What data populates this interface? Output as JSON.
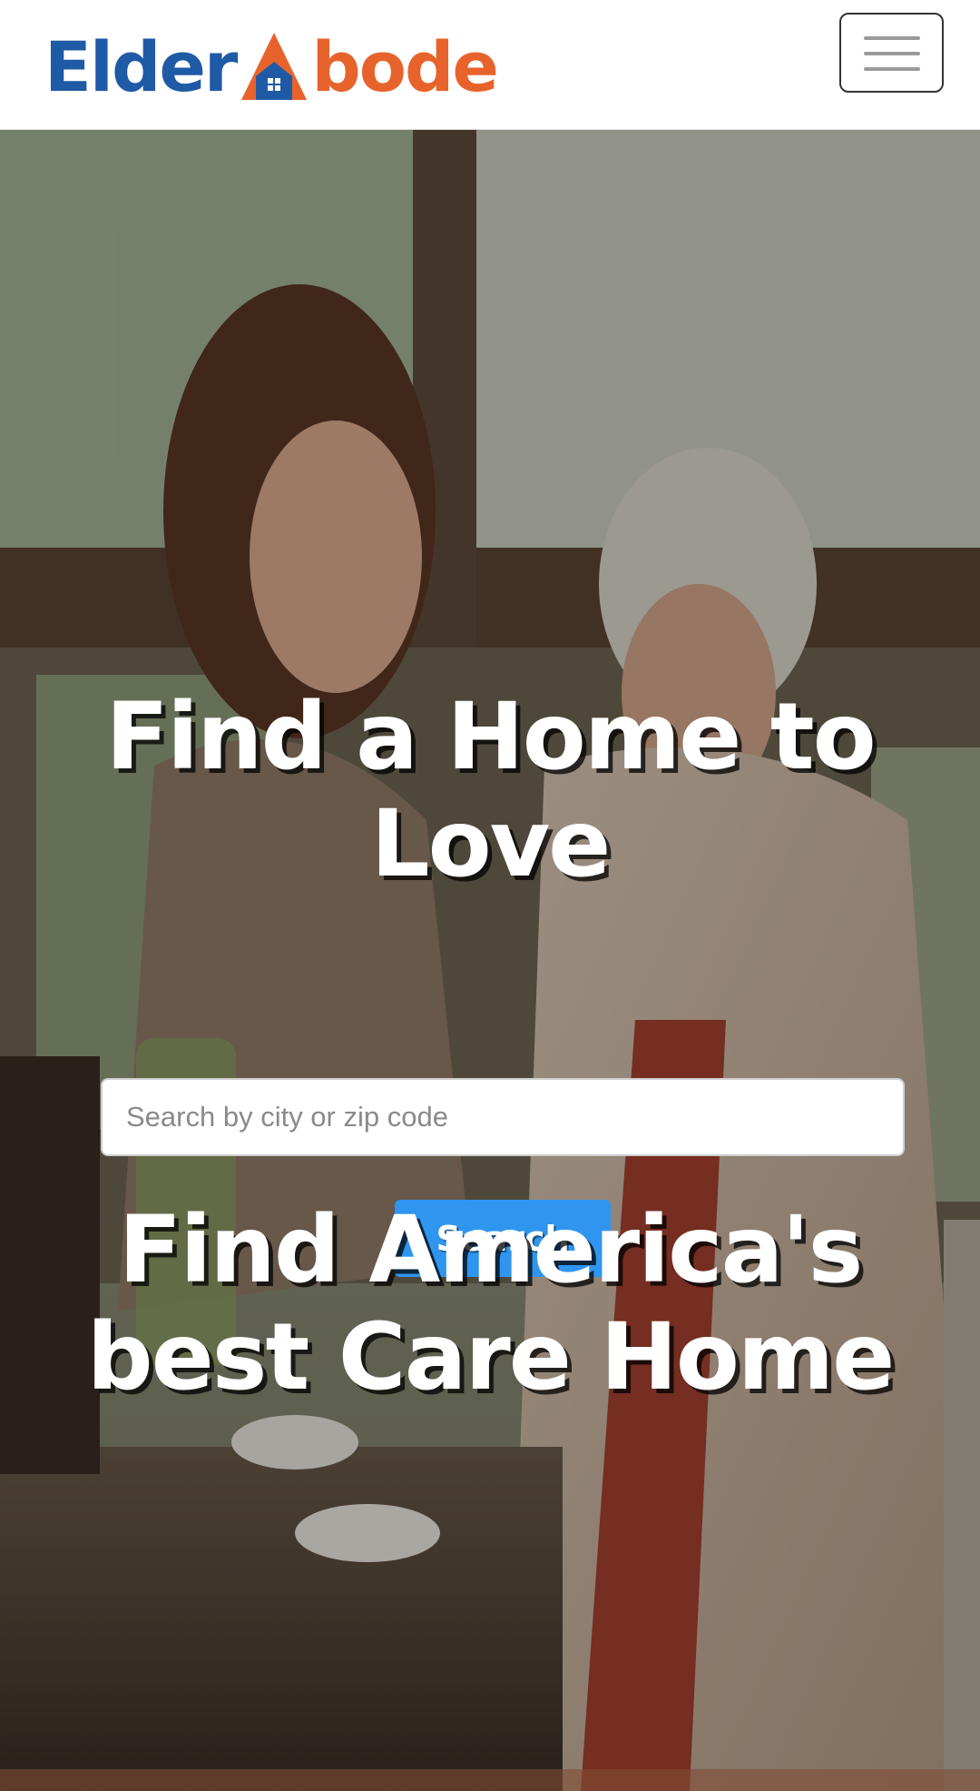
{
  "header": {
    "logo_part1": "Elder",
    "logo_part2": "bode",
    "logo_text": "ElderAbode",
    "menu_icon": "hamburger-menu-icon"
  },
  "hero": {
    "headline": "Find a Home to Love",
    "search": {
      "placeholder": "Search by city or zip code",
      "value": "",
      "button_label": "Search"
    },
    "subheadline": "Find America's best Care Home"
  },
  "colors": {
    "brand_blue": "#1f5aa6",
    "brand_orange": "#e8632c",
    "button_blue": "#2f95ef"
  }
}
